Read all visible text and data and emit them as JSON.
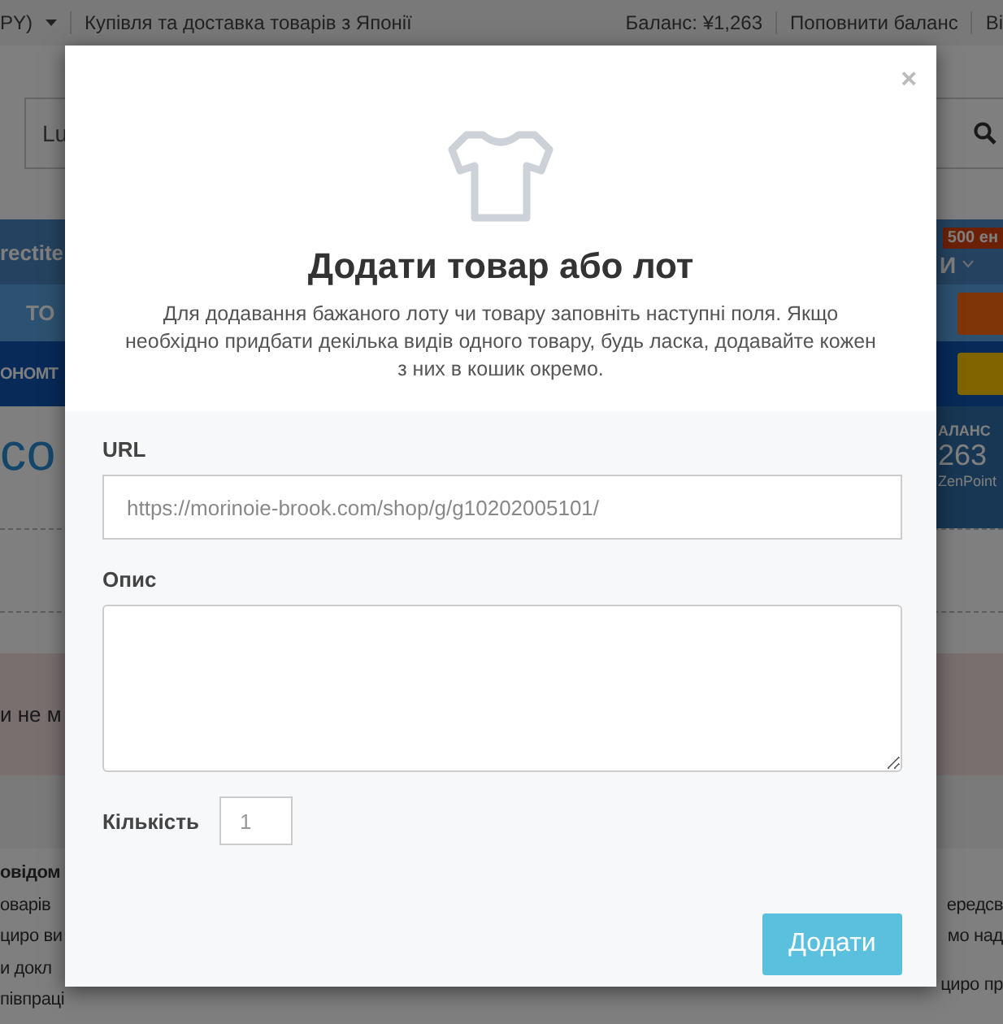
{
  "top_bar": {
    "currency": "PY)",
    "tagline": "Купівля та доставка товарів з Японії",
    "balance": "Баланс: ¥1,263",
    "top_up": "Поповнити баланс",
    "cut_link": "Ві"
  },
  "search": {
    "value": "Lu"
  },
  "nav": {
    "brand": "rectite",
    "badge": "500 ен",
    "menu": "И",
    "row_2": "ТО",
    "row_3": "ОНОМТ"
  },
  "page": {
    "heading": "со",
    "balance_panel": {
      "label": "АЛАНС",
      "value": "263",
      "unit": "ZenPoint"
    },
    "notice": "и не м",
    "text_left": [
      {
        "kind": "heading",
        "text": "овідом"
      },
      {
        "kind": "line",
        "text": "оварів"
      },
      {
        "kind": "line",
        "text": "циро ви"
      },
      {
        "kind": "line",
        "text": "и докл"
      },
      {
        "kind": "line",
        "text": "півпраці"
      }
    ],
    "text_right": [
      "ередсв",
      "мо над",
      "циро пр"
    ]
  },
  "modal": {
    "close": "×",
    "title": "Додати товар або лот",
    "description": "Для додавання бажаного лоту чи товару заповніть наступні поля. Якщо необхідно придбати декілька видів одного товару, будь ласка, додавайте кожен з них в кошик окремо.",
    "url": {
      "label": "URL",
      "placeholder": "https://morinoie-brook.com/shop/g/g10202005101/"
    },
    "description_field": {
      "label": "Опис"
    },
    "quantity": {
      "label": "Кількість",
      "placeholder": "1"
    },
    "submit": "Додати"
  }
}
